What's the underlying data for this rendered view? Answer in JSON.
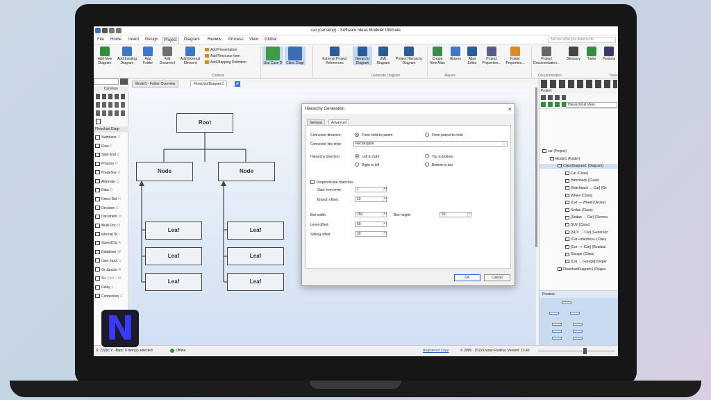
{
  "app": {
    "window_title": "car (car.simp) - Software Ideas Modeler Ultimate"
  },
  "menu": [
    "File",
    "Home",
    "Insert",
    "Design",
    "Project",
    "Diagram",
    "Review",
    "Process",
    "View",
    "Global"
  ],
  "menu_active": "Project",
  "search_placeholder": "Tell me what you want to do",
  "ribbon": {
    "buttons": [
      {
        "label": "Add New Diagram",
        "color": "#2f8f3c"
      },
      {
        "label": "Add Existing Diagram",
        "color": "#3a79c9"
      },
      {
        "label": "Add Folder",
        "color": "#3a79c9"
      },
      {
        "label": "Add Document",
        "color": "#6e6e6e"
      },
      {
        "label": "Add External Element",
        "color": "#3a79c9"
      }
    ],
    "small": [
      "Add Presentation",
      "Add Resource Item",
      "Add Mapping Definition"
    ],
    "content_group": "Content",
    "gen_buttons": [
      {
        "label": "Use Case D",
        "color": "#3f9b47"
      },
      {
        "label": "Class Diagr",
        "color": "#3a6fb6"
      },
      {
        "label": "External Project References",
        "color": "#2a5c99"
      },
      {
        "label": "Hierarchy Diagram",
        "color": "#2a5c99"
      },
      {
        "label": "UML Diagram",
        "color": "#2a5c99"
      },
      {
        "label": "Project Hierarchy Diagram",
        "color": "#2a5c99"
      }
    ],
    "generate_group": "Generate Diagram",
    "alias_buttons": [
      "Create New Alias",
      "Aliases",
      "Alias Editor",
      "Project Properties...",
      "Folder Properties..."
    ],
    "alias_group": "Aliases",
    "doc_buttons": [
      "Project Documentation...",
      "Glossary",
      "Tasks",
      "Persons"
    ],
    "doc_group": "Documentation",
    "tasks_group": "Tasks"
  },
  "left_panel": {
    "header": "Common",
    "section": "Flowchart Diagr",
    "items": [
      {
        "label": "Swimlane",
        "key": "Z"
      },
      {
        "label": "Flow",
        "key": "F"
      },
      {
        "label": "Start End",
        "key": "S"
      },
      {
        "label": "Process",
        "key": "P"
      },
      {
        "label": "Predefine",
        "key": "R"
      },
      {
        "label": "Alternate",
        "key": "Q"
      },
      {
        "label": "Data",
        "key": "D"
      },
      {
        "label": "Direct Dat",
        "key": "H"
      },
      {
        "label": "Decision",
        "key": "E"
      },
      {
        "label": "Document",
        "key": "O"
      },
      {
        "label": "Multi-Doc",
        "key": "M"
      },
      {
        "label": "Internal St",
        "key": "I"
      },
      {
        "label": "Stored Da",
        "key": "A"
      },
      {
        "label": "Database",
        "key": "W"
      },
      {
        "label": "User Input",
        "key": "U"
      },
      {
        "label": "Or Junctio",
        "key": "R"
      },
      {
        "label": "Su",
        "key": "Shift + M"
      },
      {
        "label": "Delay",
        "key": "L"
      },
      {
        "label": "Connection",
        "key": "C"
      }
    ]
  },
  "tabs": [
    "Model1 - Folder Overview",
    "FlowchartDiagram1"
  ],
  "diagram": {
    "root": "Root",
    "node": "Node",
    "leaf": "Leaf"
  },
  "dialog": {
    "title": "Hierarchy Generation",
    "tabs": [
      "General",
      "Advanced"
    ],
    "connector_direction_label": "Connector direction:",
    "dir_child_to_parent": "From child to parent",
    "dir_parent_to_child": "From parent to child",
    "connector_line_style_label": "Connector line style:",
    "connector_line_style_value": "Rectangular",
    "hierarchy_direction_label": "Hierarchy direction:",
    "left_to_right": "Left to right",
    "right_to_left": "Right to left",
    "top_to_bottom": "Top to bottom",
    "bottom_to_top": "Bottom to top",
    "perpendicular_branches": "Perpendicular branches",
    "start_from_level_label": "Start from level:",
    "start_from_level": "1",
    "branch_offset_label": "Branch offset:",
    "branch_offset": "50",
    "box_width_label": "Box width:",
    "box_width": "150",
    "box_height_label": "Box height:",
    "box_height": "50",
    "level_offset_label": "Level offset:",
    "level_offset": "60",
    "sibling_offset_label": "Sibling offset:",
    "sibling_offset": "20",
    "ok": "OK",
    "cancel": "Cancel"
  },
  "right_panel": {
    "header": "Project",
    "view_label": "Hierarchical View",
    "tree": [
      {
        "label": "car (Project)",
        "indent": 0
      },
      {
        "label": "Model1 (Folder)",
        "indent": 1
      },
      {
        "label": "ClassDiagram1 (Diagram)",
        "indent": 2
      },
      {
        "label": "Car (Class)",
        "indent": 3
      },
      {
        "label": "Hatchback (Class)",
        "indent": 3
      },
      {
        "label": "[Hatchback → Car] (Ge",
        "indent": 3
      },
      {
        "label": "Wheel (Class)",
        "indent": 3
      },
      {
        "label": "[Car — Wheel] (Associ",
        "indent": 3
      },
      {
        "label": "Sedan (Class)",
        "indent": 3
      },
      {
        "label": "[Sedan → Car] (Genera",
        "indent": 3
      },
      {
        "label": "SUV (Class)",
        "indent": 3
      },
      {
        "label": "[SUV → Car] (Generaliz",
        "indent": 3
      },
      {
        "label": "ICar «interface» (Class",
        "indent": 3
      },
      {
        "label": "[Car --> ICar] (Realizat",
        "indent": 3
      },
      {
        "label": "Garage (Class)",
        "indent": 3
      },
      {
        "label": "[Car → Garage] (Deper",
        "indent": 3
      },
      {
        "label": "FlowchartDiagram1 (Diagra",
        "indent": 2
      }
    ],
    "preview_label": "Preview"
  },
  "status": {
    "coords": "X: 232pc Y: -8bpc: 0 item(s) selected",
    "offline": "Offline",
    "registered": "Registered Copy",
    "copyright": "© 2009 - 2022 Dusan Rodina; Version: 13.40"
  },
  "logo_letter": "N"
}
